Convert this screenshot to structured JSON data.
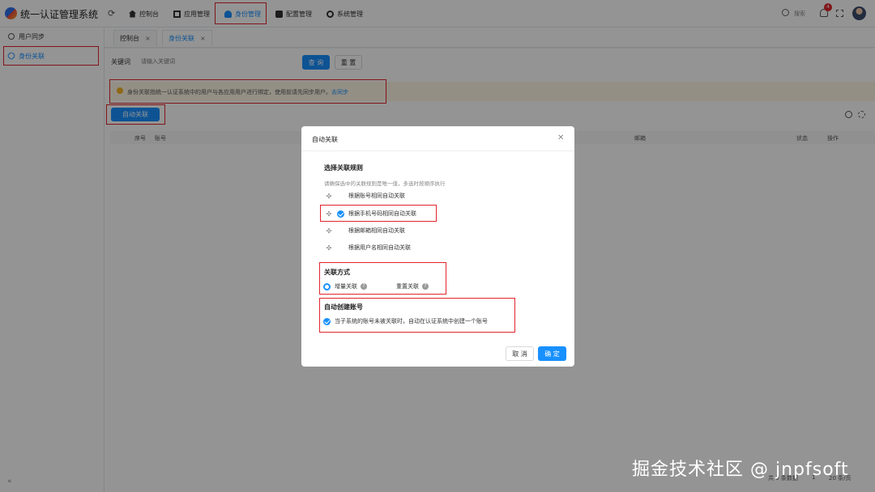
{
  "app": {
    "title": "统一认证管理系统"
  },
  "nav": [
    {
      "label": "控制台",
      "icon": "home-icon"
    },
    {
      "label": "应用管理",
      "icon": "app-icon"
    },
    {
      "label": "身份管理",
      "icon": "user-icon",
      "active": true
    },
    {
      "label": "配置管理",
      "icon": "config-icon"
    },
    {
      "label": "系统管理",
      "icon": "settings-icon"
    }
  ],
  "header": {
    "search_label": "搜索",
    "notification_count": "4"
  },
  "sidebar": {
    "items": [
      {
        "label": "用户同步"
      },
      {
        "label": "身份关联",
        "active": true
      }
    ]
  },
  "tabs": [
    {
      "label": "控制台"
    },
    {
      "label": "身份关联",
      "active": true
    }
  ],
  "filter": {
    "keyword_label": "关键词",
    "keyword_placeholder": "请输入关键词",
    "query_button": "查 询",
    "reset_button": "重 置"
  },
  "alert": {
    "text": "身份关联指统一认证系统中的用户与各应用用户进行绑定，使用前请先同步用户。",
    "link": "去同步"
  },
  "toolbar": {
    "auto_link_button": "自动关联"
  },
  "table": {
    "columns": [
      "序号",
      "账号",
      "邮箱",
      "状态",
      "操作"
    ]
  },
  "pagination": {
    "total": "共 0 条数据",
    "page": "1",
    "page_size": "20 条/页"
  },
  "modal": {
    "title": "自动关联",
    "rules_title": "选择关联规则",
    "rules_hint": "请确保选中的关联规则是唯一值，多选时按顺序执行",
    "rules": [
      {
        "label": "根据账号相同自动关联",
        "checked": false
      },
      {
        "label": "根据手机号码相同自动关联",
        "checked": true
      },
      {
        "label": "根据邮箱相同自动关联",
        "checked": false
      },
      {
        "label": "根据用户名相同自动关联",
        "checked": false
      }
    ],
    "mode_title": "关联方式",
    "modes": [
      {
        "label": "增量关联",
        "selected": true
      },
      {
        "label": "重置关联",
        "selected": false
      }
    ],
    "create_title": "自动创建账号",
    "create_option": {
      "label": "当子系统的账号未被关联时，自动在认证系统中创建一个账号",
      "checked": true
    },
    "cancel_button": "取 消",
    "confirm_button": "确 定"
  },
  "colors": {
    "primary": "#1890ff",
    "highlight": "#e0252c",
    "alert_bg": "#fdf7e6"
  },
  "watermark": "掘金技术社区 @ jnpfsoft"
}
